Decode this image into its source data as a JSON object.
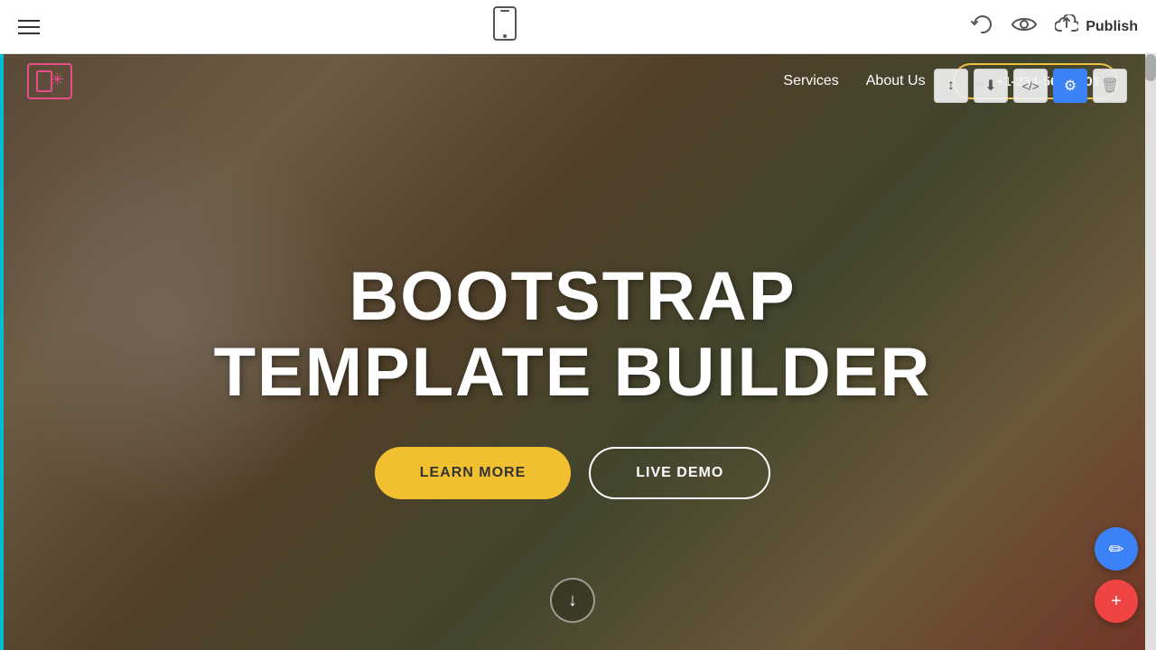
{
  "toolbar": {
    "hamburger_label": "menu",
    "phone_symbol": "☐",
    "undo_symbol": "↺",
    "eye_symbol": "◉",
    "cloud_symbol": "⬆",
    "publish_label": "Publish"
  },
  "nav": {
    "services_label": "Services",
    "about_label": "About Us",
    "phone_icon": "📱",
    "phone_number": "+1-234-567-8901"
  },
  "section_tools": {
    "sort_icon": "↕",
    "download_icon": "⬇",
    "code_icon": "</>",
    "settings_icon": "⚙",
    "delete_icon": "🗑"
  },
  "hero": {
    "title_line1": "BOOTSTRAP",
    "title_line2": "TEMPLATE BUILDER",
    "learn_more_label": "LEARN MORE",
    "live_demo_label": "LIVE DEMO",
    "scroll_icon": "↓"
  },
  "fab": {
    "edit_icon": "✏",
    "add_icon": "+"
  },
  "colors": {
    "accent_yellow": "#f0c030",
    "accent_blue": "#3b82f6",
    "accent_red": "#ef4444",
    "accent_cyan": "#00bcd4",
    "logo_pink": "#e84d8a"
  }
}
